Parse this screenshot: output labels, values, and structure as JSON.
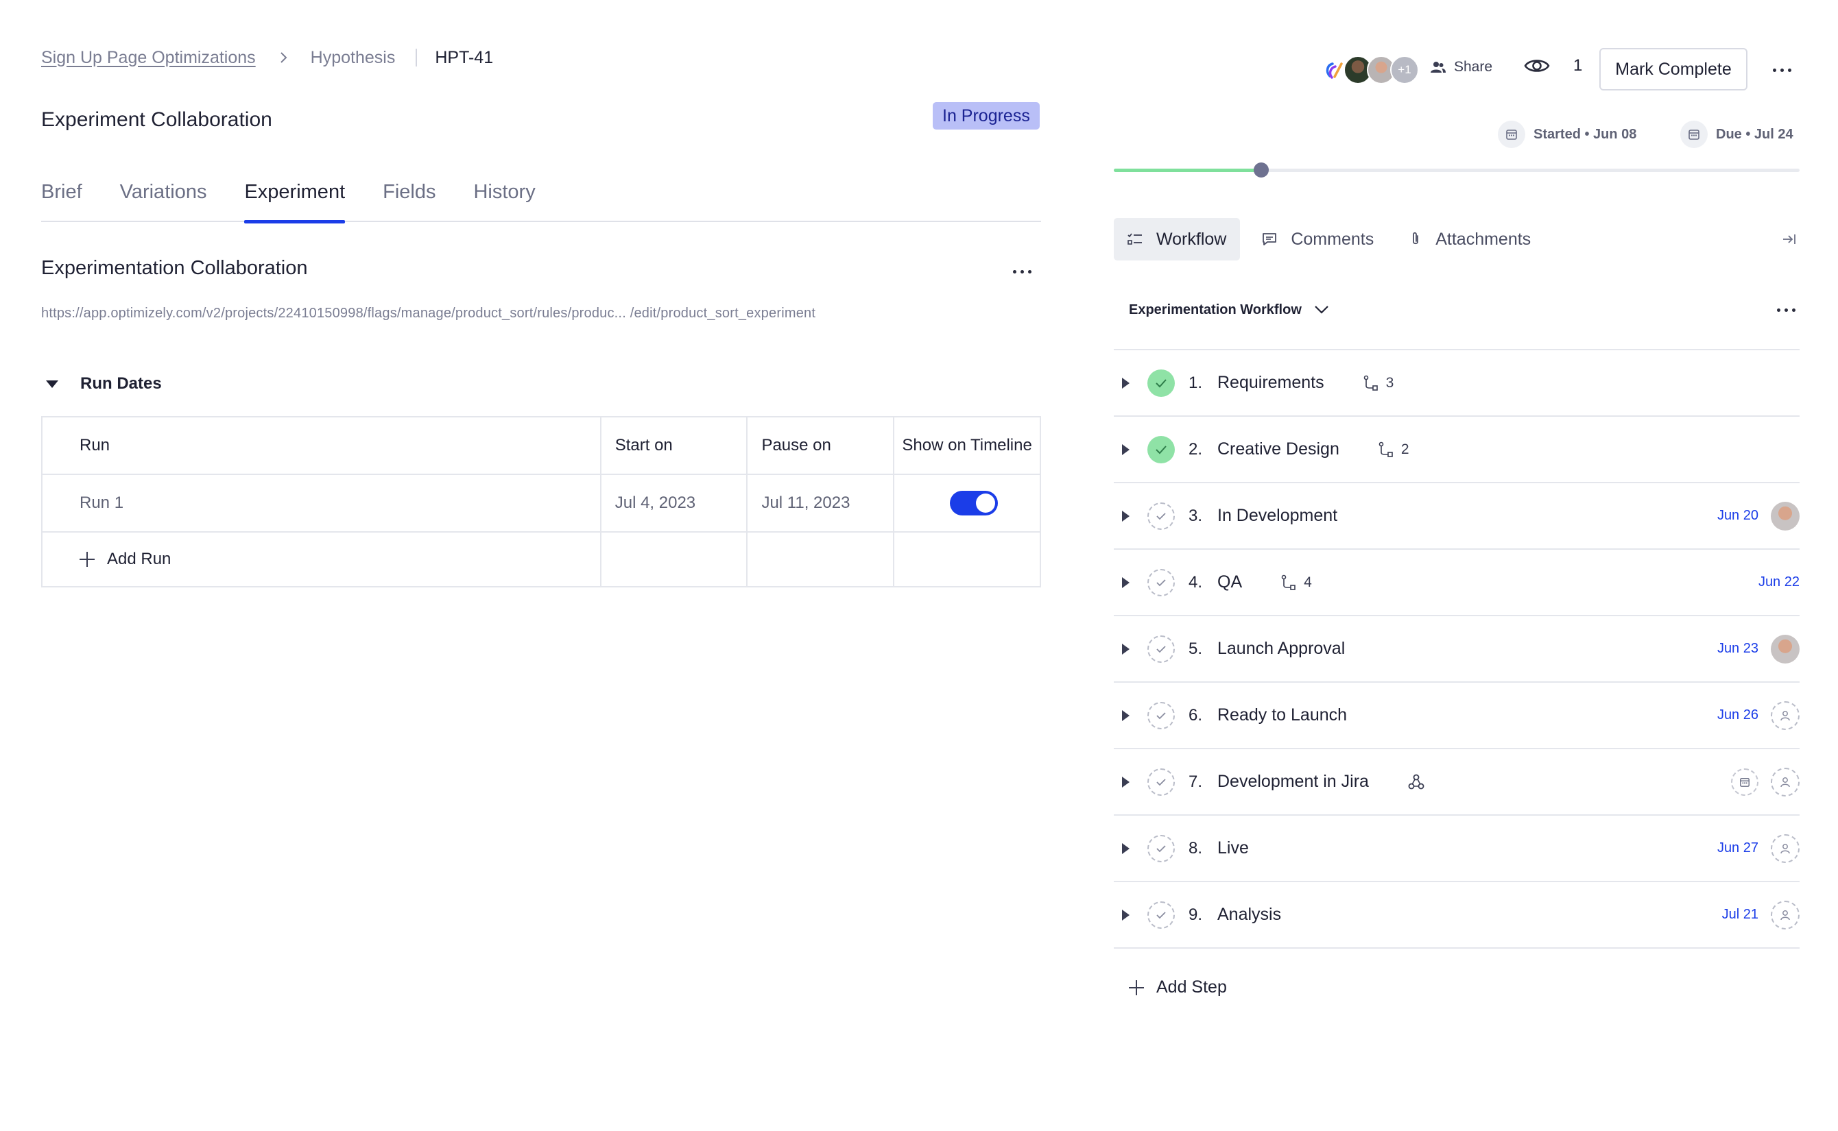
{
  "breadcrumb": {
    "project": "Sign Up Page Optimizations",
    "section": "Hypothesis",
    "current": "HPT-41"
  },
  "header": {
    "title": "Experiment Collaboration",
    "status": "In Progress",
    "status_color": "#b9bff7"
  },
  "tabs": [
    {
      "label": "Brief",
      "active": false
    },
    {
      "label": "Variations",
      "active": false
    },
    {
      "label": "Experiment",
      "active": true
    },
    {
      "label": "Fields",
      "active": false
    },
    {
      "label": "History",
      "active": false
    }
  ],
  "collaboration": {
    "title": "Experimentation Collaboration",
    "url": "https://app.optimizely.com/v2/projects/22410150998/flags/manage/product_sort/rules/produc... /edit/product_sort_experiment"
  },
  "run_dates": {
    "title": "Run Dates",
    "columns": {
      "run": "Run",
      "start": "Start on",
      "pause": "Pause on",
      "show": "Show on Timeline"
    },
    "rows": [
      {
        "run": "Run 1",
        "start": "Jul 4, 2023",
        "pause": "Jul 11, 2023",
        "show_on_timeline": true
      }
    ],
    "add_label": "Add Run"
  },
  "topbar": {
    "collaborators_more": "+1",
    "share_label": "Share",
    "watchers": "1",
    "mark_complete": "Mark Complete",
    "started": "Started • Jun 08",
    "due": "Due • Jul 24",
    "progress_fraction": 0.215,
    "accent": "#1b3de8",
    "progress_color": "#7fe09c"
  },
  "side_tabs": [
    {
      "label": "Workflow",
      "icon": "checklist-icon",
      "active": true
    },
    {
      "label": "Comments",
      "icon": "comment-icon",
      "active": false
    },
    {
      "label": "Attachments",
      "icon": "paperclip-icon",
      "active": false
    }
  ],
  "workflow": {
    "name": "Experimentation Workflow",
    "steps": [
      {
        "num": "1.",
        "label": "Requirements",
        "done": true,
        "subtasks": "3",
        "date": "",
        "assignee": "none"
      },
      {
        "num": "2.",
        "label": "Creative Design",
        "done": true,
        "subtasks": "2",
        "date": "",
        "assignee": "none"
      },
      {
        "num": "3.",
        "label": "In Development",
        "done": false,
        "subtasks": "",
        "date": "Jun 20",
        "assignee": "photo"
      },
      {
        "num": "4.",
        "label": "QA",
        "done": false,
        "subtasks": "4",
        "date": "Jun 22",
        "assignee": "none"
      },
      {
        "num": "5.",
        "label": "Launch Approval",
        "done": false,
        "subtasks": "",
        "date": "Jun 23",
        "assignee": "photo"
      },
      {
        "num": "6.",
        "label": "Ready to Launch",
        "done": false,
        "subtasks": "",
        "date": "Jun 26",
        "assignee": "empty"
      },
      {
        "num": "7.",
        "label": "Development in Jira",
        "done": false,
        "subtasks": "",
        "integration": "webhook-icon",
        "date": "",
        "assignee": "empty",
        "calendar": true
      },
      {
        "num": "8.",
        "label": "Live",
        "done": false,
        "subtasks": "",
        "date": "Jun 27",
        "assignee": "empty"
      },
      {
        "num": "9.",
        "label": "Analysis",
        "done": false,
        "subtasks": "",
        "date": "Jul 21",
        "assignee": "empty"
      }
    ],
    "add_label": "Add Step"
  }
}
